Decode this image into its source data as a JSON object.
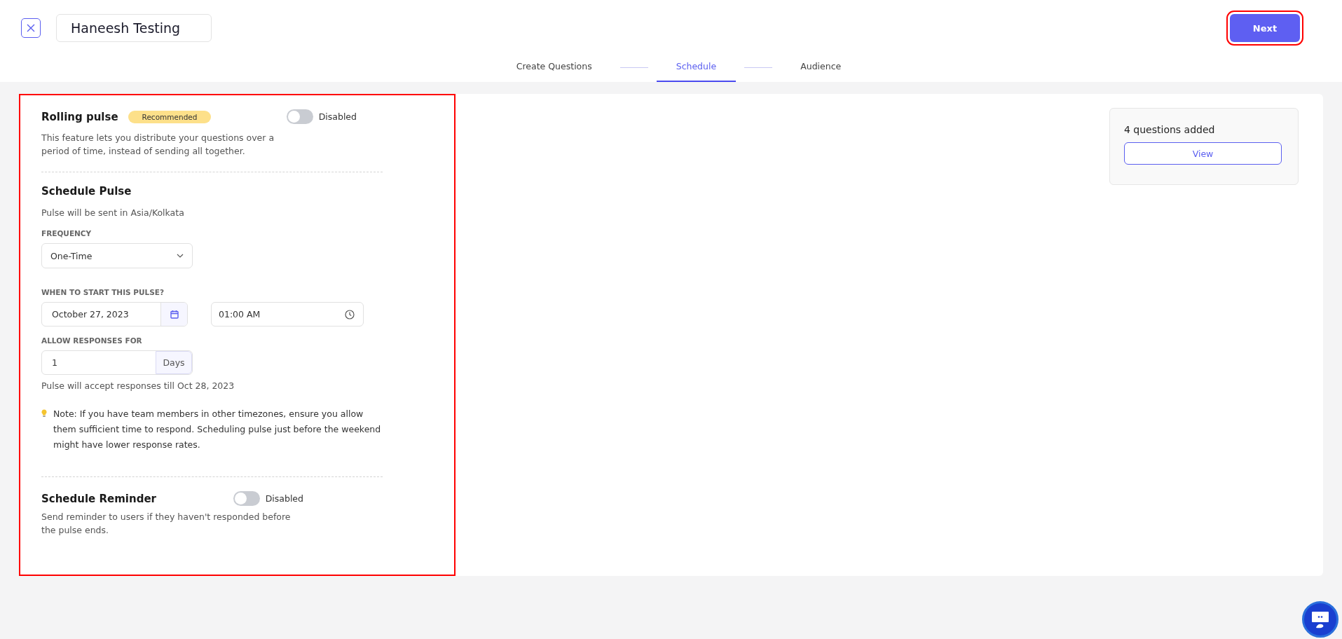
{
  "header": {
    "title_field": {
      "value": "Haneesh Testing"
    },
    "next_button": "Next"
  },
  "steps": [
    {
      "label": "Create Questions",
      "selected": false
    },
    {
      "label": "Schedule",
      "selected": true
    },
    {
      "label": "Audience",
      "selected": false
    }
  ],
  "rolling_pulse": {
    "title": "Rolling pulse",
    "badge": "Recommended",
    "toggle": {
      "on": false,
      "label": "Disabled"
    },
    "description": "This feature lets you distribute your questions over a\nperiod of time, instead of sending all together."
  },
  "schedule_pulse": {
    "title": "Schedule Pulse",
    "timezone_note": "Pulse will be sent in Asia/Kolkata",
    "frequency": {
      "label": "FREQUENCY",
      "value": "One-Time"
    },
    "start": {
      "label": "WHEN TO START THIS PULSE?",
      "date": "October 27, 2023",
      "time": "01:00 AM"
    },
    "allow_responses": {
      "label": "ALLOW RESPONSES FOR",
      "value": "1",
      "unit": "Days"
    },
    "accept_note": "Pulse will accept responses till Oct 28, 2023",
    "tip": "Note: If you have team members in other timezones, ensure you allow\nthem sufficient time to respond. Scheduling pulse just before the weekend\nmight have lower response rates."
  },
  "schedule_reminder": {
    "title": "Schedule Reminder",
    "toggle": {
      "on": false,
      "label": "Disabled"
    },
    "description": "Send reminder to users if they haven't responded before\nthe pulse ends."
  },
  "summary": {
    "count": "4 questions added",
    "view_button": "View"
  }
}
